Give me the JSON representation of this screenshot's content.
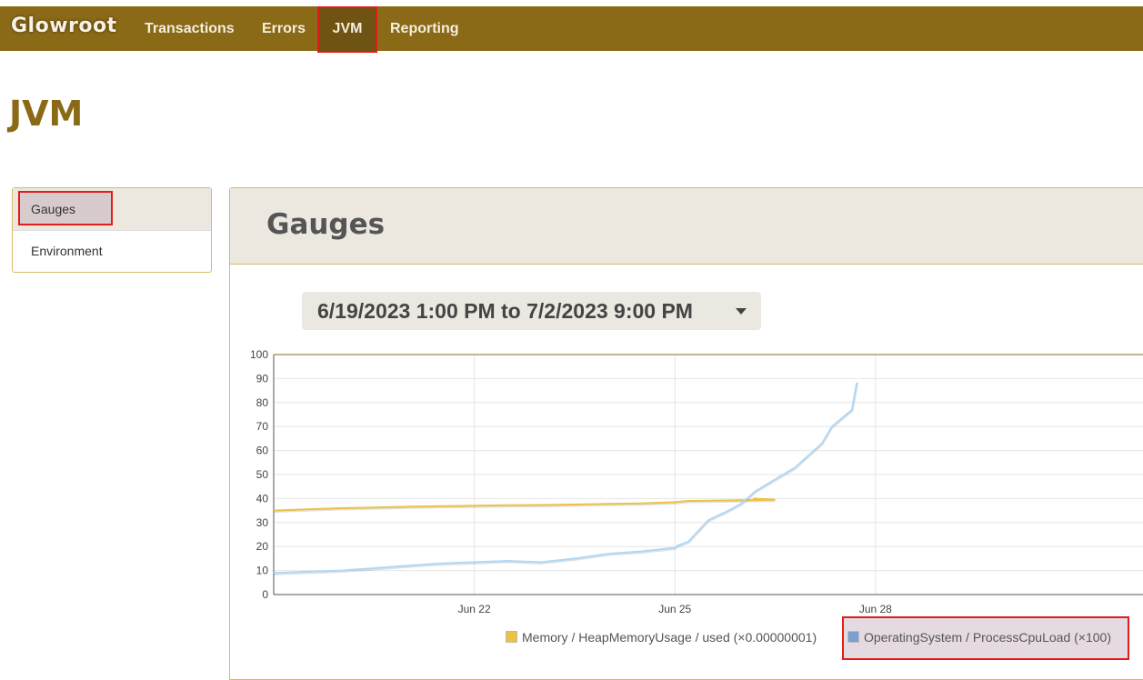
{
  "navbar": {
    "brand": "Glowroot",
    "items": [
      {
        "label": "Transactions"
      },
      {
        "label": "Errors"
      },
      {
        "label": "JVM"
      },
      {
        "label": "Reporting"
      }
    ]
  },
  "page": {
    "title": "JVM"
  },
  "sidebar": {
    "items": [
      {
        "label": "Gauges"
      },
      {
        "label": "Environment"
      }
    ]
  },
  "panel": {
    "title": "Gauges",
    "range_label": "6/19/2023 1:00 PM to 7/2/2023 9:00 PM"
  },
  "colors": {
    "navbar_bg": "#8a6a17",
    "memory_series": "#edc240",
    "cpu_series": "#afd8f8"
  },
  "chart_data": {
    "type": "line",
    "x_tick_labels": [
      "Jun 22",
      "Jun 25",
      "Jun 28"
    ],
    "y_ticks": [
      0,
      10,
      20,
      30,
      40,
      50,
      60,
      70,
      80,
      90,
      100
    ],
    "ylim": [
      0,
      100
    ],
    "xlim": [
      0,
      13
    ],
    "x_ticks": [
      3,
      6,
      9
    ],
    "grid": true,
    "legend_position": "bottom",
    "series": [
      {
        "name": "Memory / HeapMemoryUsage / used (×0.00000001)",
        "color": "#edc240",
        "x": [
          0,
          0.5,
          1,
          1.5,
          2,
          2.5,
          3,
          3.5,
          4,
          4.5,
          5,
          5.5,
          6,
          6.2,
          6.5,
          7,
          7.5,
          7.17
        ],
        "y": [
          35,
          35.5,
          36,
          36.3,
          36.6,
          36.8,
          37,
          37.2,
          37.3,
          37.5,
          37.8,
          38,
          38.5,
          39,
          39.1,
          39.3,
          39.5,
          40
        ]
      },
      {
        "name": "OperatingSystem / ProcessCpuLoad (×100)",
        "color": "#afd8f8",
        "x": [
          0,
          0.5,
          1,
          1.5,
          2,
          2.5,
          3,
          3.5,
          4,
          4.5,
          5,
          5.5,
          6,
          6.05,
          6.2,
          6.5,
          6.8,
          7.0,
          7.2,
          7.5,
          7.8,
          8.0,
          8.2,
          8.35,
          8.65,
          8.72,
          8.74
        ],
        "y": [
          9,
          9.5,
          10,
          11,
          12,
          13,
          13.5,
          14,
          13.5,
          15,
          17,
          18,
          19.5,
          20.5,
          22,
          31,
          35,
          38,
          43,
          48,
          53,
          58,
          63,
          70,
          77,
          88,
          88
        ]
      }
    ]
  }
}
